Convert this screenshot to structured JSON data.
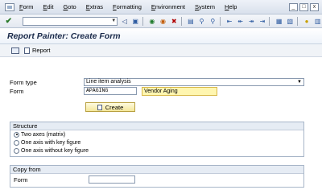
{
  "menu": {
    "items": [
      "Form",
      "Edit",
      "Goto",
      "Extras",
      "Formatting",
      "Environment",
      "System",
      "Help"
    ]
  },
  "window": {
    "controls": [
      "_",
      "□",
      "x"
    ]
  },
  "title": "Report Painter: Create Form",
  "app_toolbar": {
    "report_label": "Report"
  },
  "form": {
    "form_type_label": "Form type",
    "form_type_value": "Line item analysis",
    "form_label": "Form",
    "form_value": "APAGING",
    "form_desc": "Vendor Aging",
    "create_label": "Create"
  },
  "structure": {
    "title": "Structure",
    "options": [
      {
        "label": "Two axes (matrix)",
        "selected": true
      },
      {
        "label": "One axis with key figure",
        "selected": false
      },
      {
        "label": "One axis without key figure",
        "selected": false
      }
    ]
  },
  "copy_from": {
    "title": "Copy from",
    "form_label": "Form",
    "form_value": ""
  }
}
